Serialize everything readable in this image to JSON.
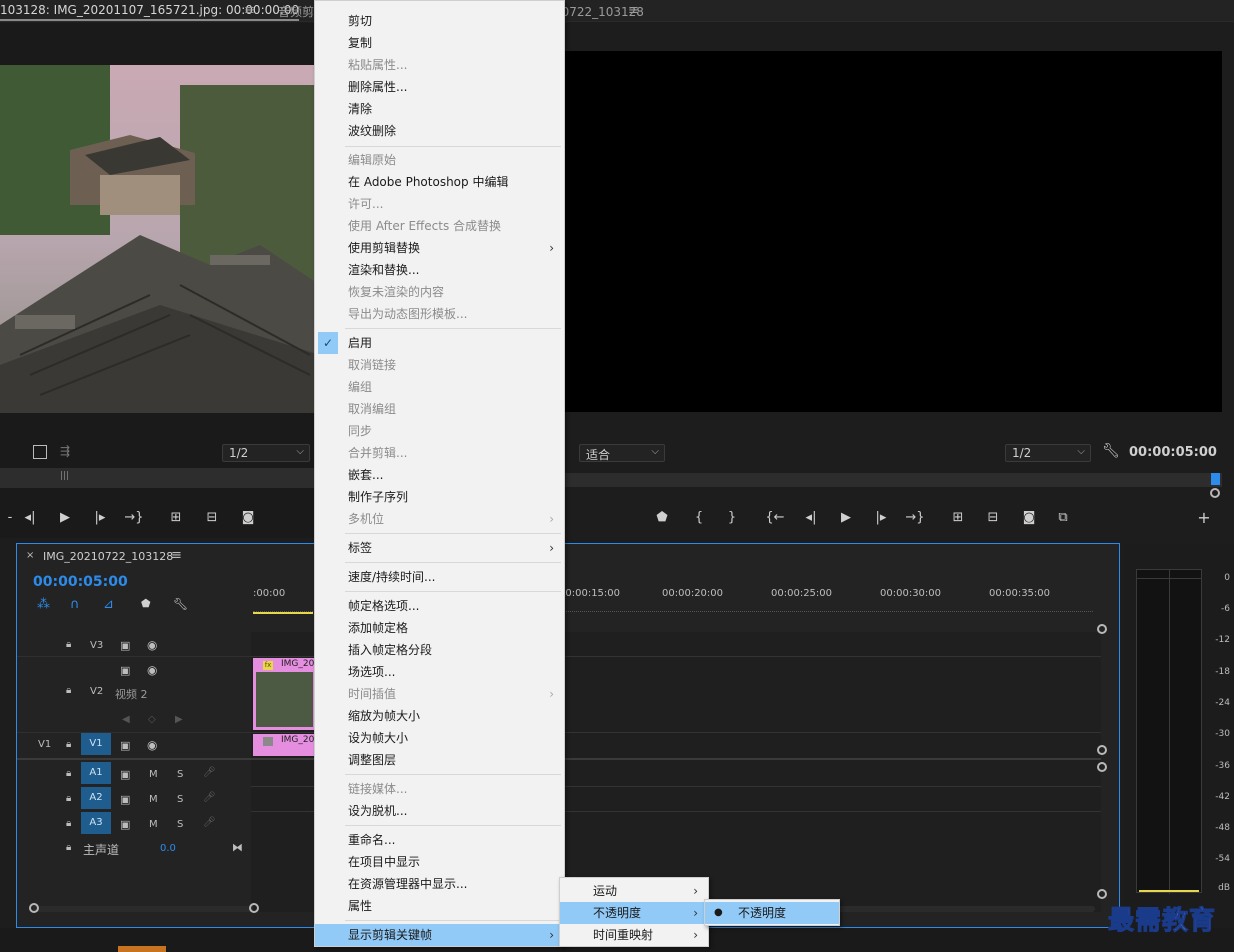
{
  "tabs": {
    "source": "103128: IMG_20201107_165721.jpg: 00:00:00:00",
    "audio_mixer": "音频剪辑混合器",
    "program": "节目: IMG_20210722_103128"
  },
  "source_monitor": {
    "resolution": "1/2"
  },
  "program_monitor": {
    "fit": "适合",
    "resolution": "1/2",
    "timecode": "00:00:05:00"
  },
  "timeline": {
    "sequence_name": "IMG_20210722_103128",
    "timecode": "00:00:05:00",
    "ruler": [
      ":00:00",
      "00:00:15:00",
      "00:00:20:00",
      "00:00:25:00",
      "00:00:30:00",
      "00:00:35:00"
    ],
    "tracks": {
      "v3": "V3",
      "v2": "V2",
      "v2_name": "视频 2",
      "v1_src": "V1",
      "v1": "V1",
      "a1": "A1",
      "a2": "A2",
      "a3": "A3",
      "m": "M",
      "s": "S",
      "master": "主声道",
      "master_value": "0.0"
    },
    "clip_v2": "IMG_20",
    "clip_v1": "IMG_20",
    "fx": "fx"
  },
  "meter": {
    "labels": [
      "0",
      "-6",
      "-12",
      "-18",
      "-24",
      "-30",
      "-36",
      "-42",
      "-48",
      "-54",
      "dB"
    ]
  },
  "context_menu": {
    "items": [
      {
        "label": "剪切",
        "disabled": false
      },
      {
        "label": "复制",
        "disabled": false
      },
      {
        "label": "粘贴属性...",
        "disabled": true
      },
      {
        "label": "删除属性...",
        "disabled": false
      },
      {
        "label": "清除",
        "disabled": false
      },
      {
        "label": "波纹删除",
        "disabled": false
      },
      {
        "label": "编辑原始",
        "disabled": true
      },
      {
        "label": "在 Adobe Photoshop 中编辑",
        "disabled": false
      },
      {
        "label": "许可...",
        "disabled": true
      },
      {
        "label": "使用 After Effects 合成替换",
        "disabled": true
      },
      {
        "label": "使用剪辑替换",
        "disabled": false,
        "submenu": true
      },
      {
        "label": "渲染和替换...",
        "disabled": false
      },
      {
        "label": "恢复未渲染的内容",
        "disabled": true
      },
      {
        "label": "导出为动态图形模板...",
        "disabled": true
      },
      {
        "label": "启用",
        "disabled": false,
        "checked": true
      },
      {
        "label": "取消链接",
        "disabled": true
      },
      {
        "label": "编组",
        "disabled": true
      },
      {
        "label": "取消编组",
        "disabled": true
      },
      {
        "label": "同步",
        "disabled": true
      },
      {
        "label": "合并剪辑...",
        "disabled": true
      },
      {
        "label": "嵌套...",
        "disabled": false
      },
      {
        "label": "制作子序列",
        "disabled": false
      },
      {
        "label": "多机位",
        "disabled": true,
        "submenu": true
      },
      {
        "label": "标签",
        "disabled": false,
        "submenu": true
      },
      {
        "label": "速度/持续时间...",
        "disabled": false
      },
      {
        "label": "帧定格选项...",
        "disabled": false
      },
      {
        "label": "添加帧定格",
        "disabled": false
      },
      {
        "label": "插入帧定格分段",
        "disabled": false
      },
      {
        "label": "场选项...",
        "disabled": false
      },
      {
        "label": "时间插值",
        "disabled": true,
        "submenu": true
      },
      {
        "label": "缩放为帧大小",
        "disabled": false
      },
      {
        "label": "设为帧大小",
        "disabled": false
      },
      {
        "label": "调整图层",
        "disabled": false
      },
      {
        "label": "链接媒体...",
        "disabled": true
      },
      {
        "label": "设为脱机...",
        "disabled": false
      },
      {
        "label": "重命名...",
        "disabled": false
      },
      {
        "label": "在项目中显示",
        "disabled": false
      },
      {
        "label": "在资源管理器中显示...",
        "disabled": false
      },
      {
        "label": "属性",
        "disabled": false
      },
      {
        "label": "显示剪辑关键帧",
        "disabled": false,
        "submenu": true,
        "highlighted": true
      }
    ]
  },
  "submenu_keyframes": {
    "items": [
      {
        "label": "运动",
        "submenu": true
      },
      {
        "label": "不透明度",
        "submenu": true,
        "highlighted": true
      },
      {
        "label": "时间重映射",
        "submenu": true
      }
    ]
  },
  "submenu_opacity": {
    "items": [
      {
        "label": "不透明度",
        "selected": true
      }
    ]
  },
  "watermark": "最需教育",
  "colors": {
    "accent_blue": "#2d8ceb",
    "menu_highlight": "#91c9f7",
    "clip_pink": "#e58ee0",
    "track_target": "#1f5d8e",
    "playhead_yellow": "#e6d84a"
  }
}
